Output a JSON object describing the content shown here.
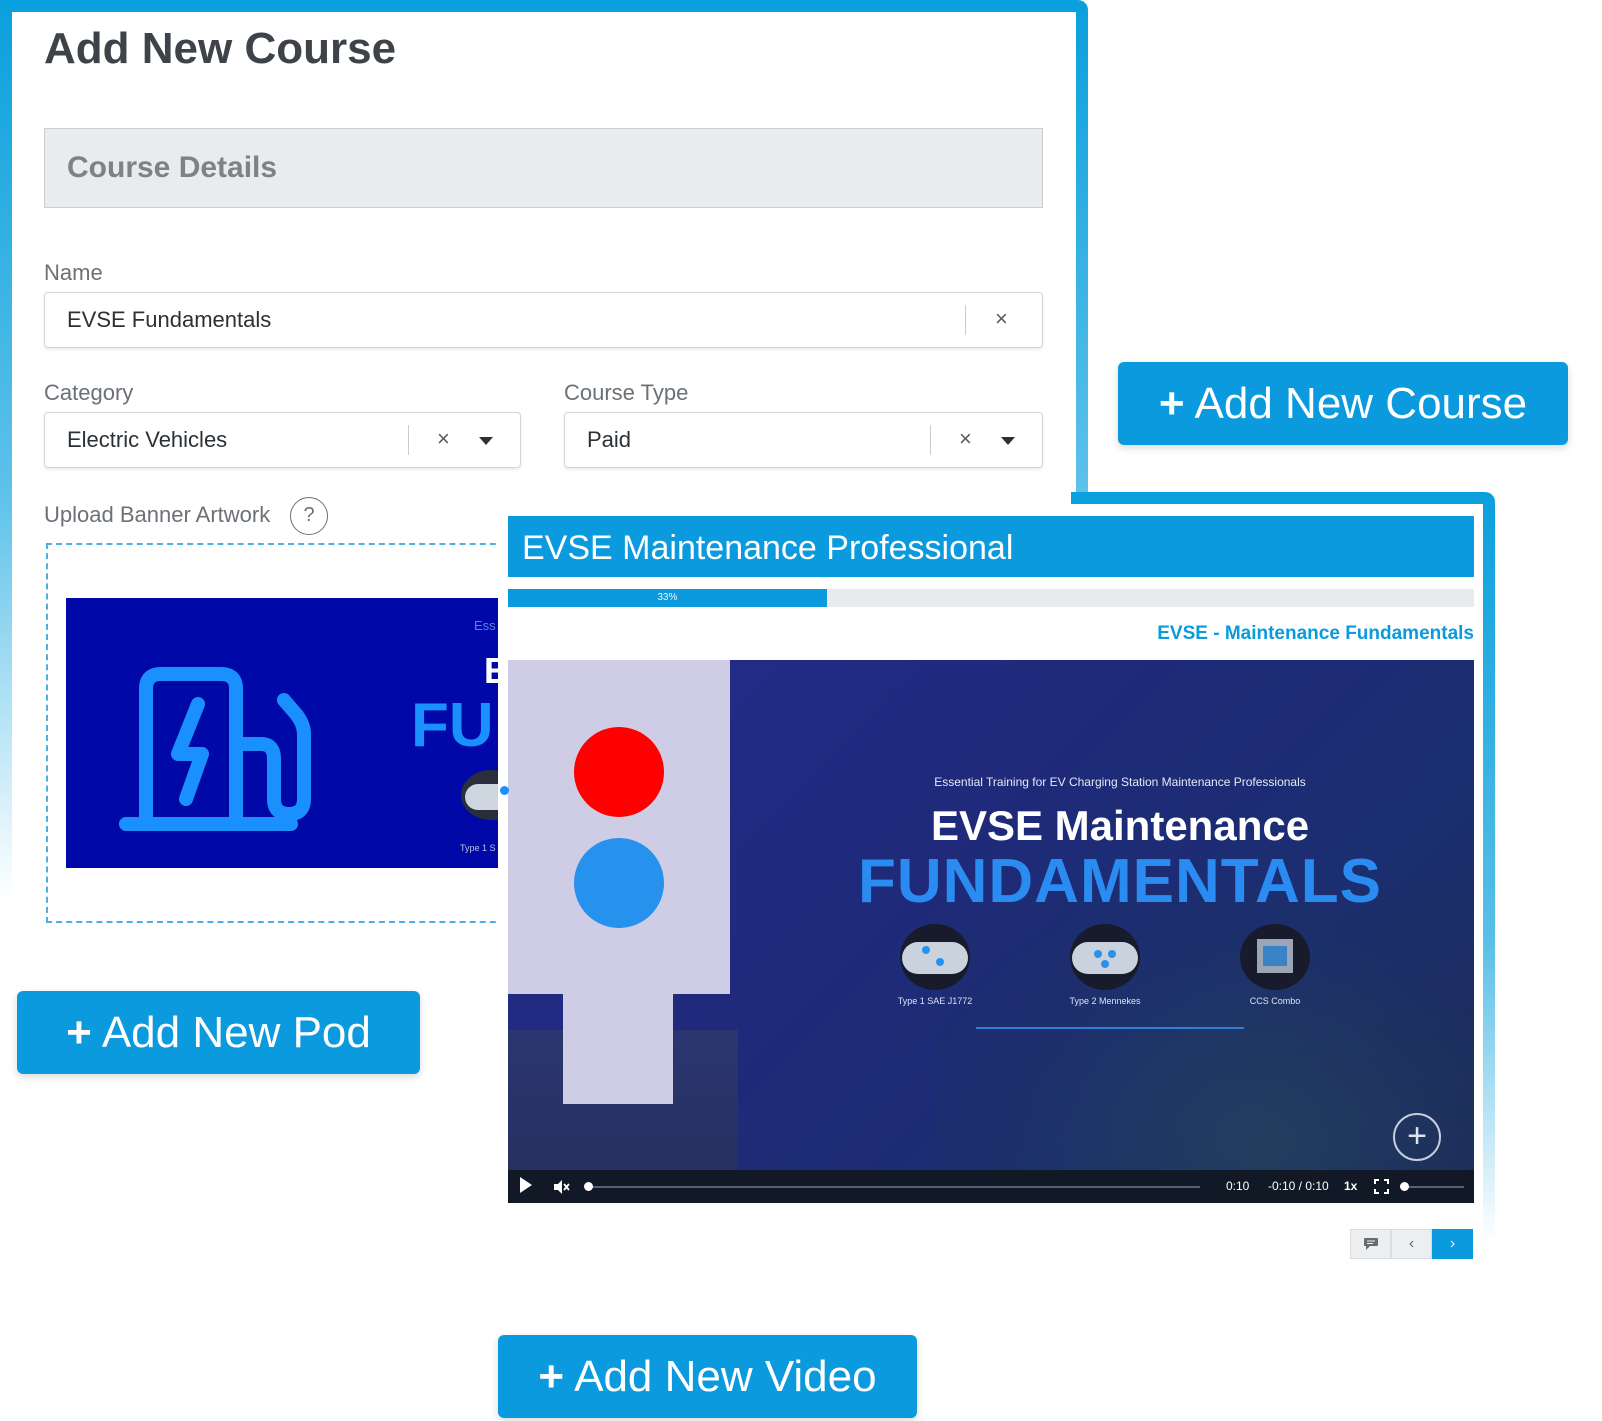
{
  "course_form": {
    "title": "Add New Course",
    "section_title": "Course Details",
    "name": {
      "label": "Name",
      "value": "EVSE Fundamentals",
      "clear_icon": "×"
    },
    "category": {
      "label": "Category",
      "value": "Electric Vehicles",
      "clear_icon": "×"
    },
    "course_type": {
      "label": "Course Type",
      "value": "Paid",
      "clear_icon": "×"
    },
    "upload": {
      "label": "Upload Banner Artwork",
      "help_icon": "?",
      "banner_preview": {
        "sub": "Ess",
        "line1": "E",
        "line2": "FU",
        "type": "Type 1 S"
      }
    }
  },
  "buttons": {
    "add_course": {
      "plus": "+",
      "label": "Add New Course"
    },
    "add_pod": {
      "plus": "+",
      "label": "Add New Pod"
    },
    "add_video": {
      "plus": "+",
      "label": "Add New Video"
    }
  },
  "pod": {
    "title": "EVSE Maintenance Professional",
    "progress": {
      "percent": 33,
      "label": "33%"
    },
    "lesson_title": "EVSE - Maintenance Fundamentals",
    "video": {
      "subtitle": "Essential Training for EV Charging Station Maintenance Professionals",
      "title": "EVSE Maintenance",
      "big_title": "FUNDAMENTALS",
      "connectors": [
        "Type 1 SAE J1772",
        "Type 2 Mennekes",
        "CCS Combo"
      ],
      "plus_icon": "+",
      "controls": {
        "current_time": "0:10",
        "remaining": "-0:10 / 0:10",
        "speed": "1x",
        "playback_position": 0,
        "volume": 0
      }
    },
    "nav": {
      "comment_icon": "comment-icon",
      "prev": "‹",
      "next": "›"
    }
  },
  "colors": {
    "accent": "#0b9add",
    "banner_bg": "#0009a8",
    "red_light": "#ff0000",
    "blue_light": "#2791ee"
  }
}
